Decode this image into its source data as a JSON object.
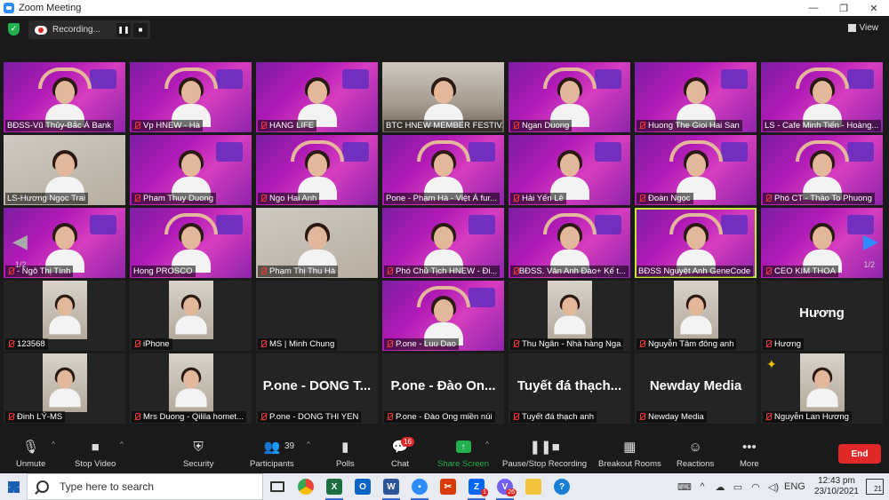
{
  "window": {
    "title": "Zoom Meeting",
    "minimize": "—",
    "maximize": "❐",
    "close": "✕"
  },
  "topbar": {
    "recording_label": "Recording...",
    "pause_glyph": "❚❚",
    "stop_glyph": "■",
    "view_label": "View"
  },
  "gallery": {
    "page_left": "1/2",
    "page_right": "1/2",
    "tiles": [
      {
        "label": "BĐSS-Vũ Thủy-Bắc Á Bank",
        "muted": false,
        "style": "pink"
      },
      {
        "label": "Vp HNEW - Hà",
        "muted": true,
        "style": "pink"
      },
      {
        "label": "HANG LIFE",
        "muted": true,
        "style": "pink"
      },
      {
        "label": "BTC HNEW MEMBER FESTIVAL",
        "muted": false,
        "style": "room"
      },
      {
        "label": "Ngan Duong",
        "muted": true,
        "style": "pink"
      },
      {
        "label": "Huong The Gioi Hai San",
        "muted": true,
        "style": "pink"
      },
      {
        "label": "LS - Cafe Minh Tiến - Hoàng...",
        "muted": false,
        "style": "pink"
      },
      {
        "label": "LS-Hương Ngọc Trai",
        "muted": false,
        "style": "home"
      },
      {
        "label": "Pham Thuy Duong",
        "muted": true,
        "style": "pink"
      },
      {
        "label": "Ngo Hai Anh",
        "muted": true,
        "style": "pink"
      },
      {
        "label": "Pone - Phạm Hà - Việt Á fur...",
        "muted": false,
        "style": "pink"
      },
      {
        "label": "Hải Yến Lê",
        "muted": true,
        "style": "pink"
      },
      {
        "label": "Đoàn Ngọc",
        "muted": true,
        "style": "pink"
      },
      {
        "label": "Phó CT - Thảo To Phuong",
        "muted": true,
        "style": "pink"
      },
      {
        "label": "- Ngô Thị Tính",
        "muted": true,
        "style": "pink"
      },
      {
        "label": "Hong PROSCO",
        "muted": false,
        "style": "pink"
      },
      {
        "label": "Phạm Thị Thu Hà",
        "muted": true,
        "style": "home"
      },
      {
        "label": "Phó Chủ Tịch HNEW - Đi...",
        "muted": true,
        "style": "pink"
      },
      {
        "label": "BĐSS. Vân Anh Đào+ Kế t...",
        "muted": true,
        "style": "pink"
      },
      {
        "label": "BĐSS Nguyệt Anh GeneCode",
        "muted": false,
        "style": "pink",
        "active": true
      },
      {
        "label": "CEO KIM THOA",
        "muted": true,
        "style": "pink"
      },
      {
        "label": "123568",
        "muted": true,
        "style": "dark-video"
      },
      {
        "label": "iPhone",
        "muted": true,
        "style": "dark-video"
      },
      {
        "label": "MS | Minh Chung",
        "muted": true,
        "style": "dark"
      },
      {
        "label": "P.one - Luu Dao",
        "muted": true,
        "style": "pink"
      },
      {
        "label": "Thu Ngân - Nhà hàng Nga",
        "muted": true,
        "style": "dark-video"
      },
      {
        "label": "Nguyễn Tâm đông anh",
        "muted": true,
        "style": "dark-video"
      },
      {
        "label": "Hương",
        "muted": true,
        "style": "dark",
        "big": "Hương"
      },
      {
        "label": "Đinh LÝ-MS",
        "muted": true,
        "style": "dark-video"
      },
      {
        "label": "Mrs Duong - Qilila homet...",
        "muted": true,
        "style": "dark-video"
      },
      {
        "label": "P.one - DONG THI YEN",
        "muted": true,
        "style": "dark",
        "big": "P.one - DONG T..."
      },
      {
        "label": "P.one - Đào Ong miền núi",
        "muted": true,
        "style": "dark",
        "big": "P.one - Đào On..."
      },
      {
        "label": "Tuyết đá thạch anh",
        "muted": true,
        "style": "dark",
        "big": "Tuyết đá thạch..."
      },
      {
        "label": "Newday Media",
        "muted": true,
        "style": "dark",
        "big": "Newday Media"
      },
      {
        "label": "Nguyễn Lan Hương",
        "muted": true,
        "style": "dark-video",
        "party": true
      }
    ]
  },
  "toolbar": {
    "unmute": "Unmute",
    "stop_video": "Stop Video",
    "security": "Security",
    "participants": "Participants",
    "participants_count": "39",
    "polls": "Polls",
    "chat": "Chat",
    "chat_badge": "16",
    "share_screen": "Share Screen",
    "pause_stop_recording": "Pause/Stop Recording",
    "breakout_rooms": "Breakout Rooms",
    "reactions": "Reactions",
    "more": "More",
    "end": "End"
  },
  "taskbar": {
    "search_placeholder": "Type here to search",
    "zalo_badge": "1",
    "viber_badge": "26",
    "lang": "ENG",
    "time": "12:43 pm",
    "date": "23/10/2021",
    "notifications": "21"
  },
  "colors": {
    "accent": "#2d8cff",
    "end_red": "#e02828",
    "share_green": "#22b14c",
    "active_border": "#c8e63c"
  }
}
